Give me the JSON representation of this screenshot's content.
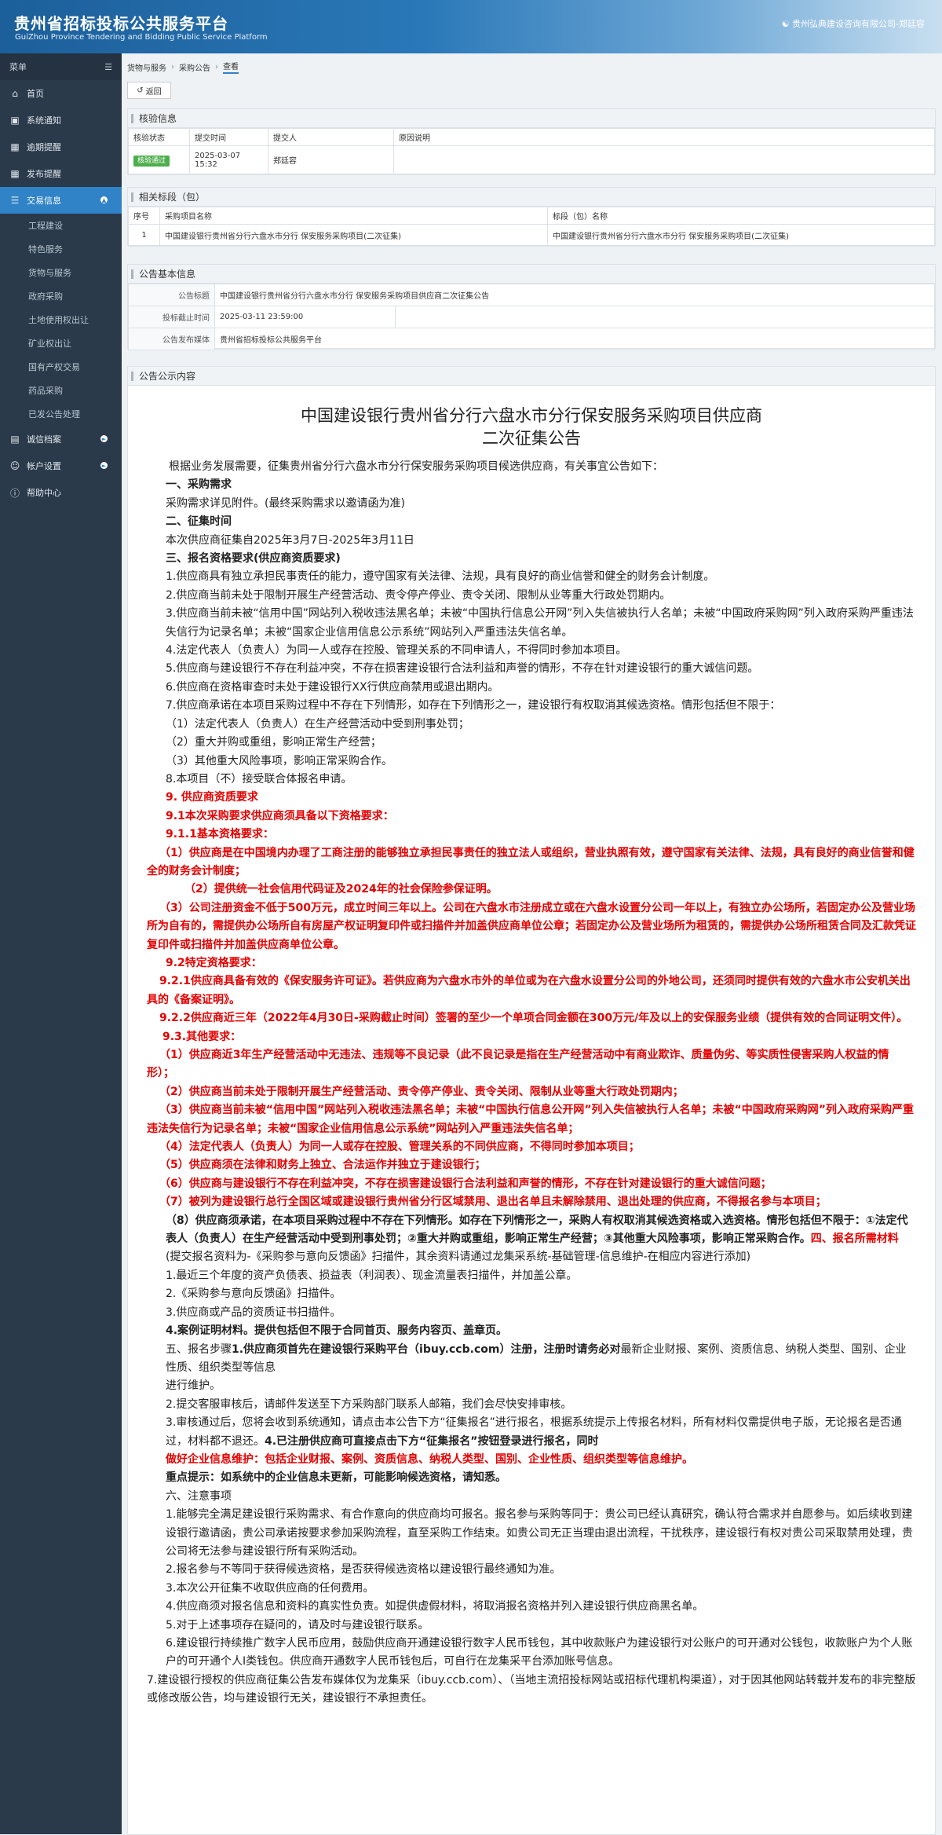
{
  "header": {
    "title": "贵州省招标投标公共服务平台",
    "subtitle": "GuiZhou Province Tendering and Bidding Public Service Platform",
    "user": "贵州弘典建设咨询有限公司-郑廷容"
  },
  "sidebar": {
    "menu_label": "菜单",
    "items": [
      {
        "label": "首页",
        "icon": "home-icon"
      },
      {
        "label": "系统通知",
        "icon": "monitor-icon"
      },
      {
        "label": "逾期提醒",
        "icon": "calendar-icon"
      },
      {
        "label": "发布提醒",
        "icon": "calendar-icon"
      },
      {
        "label": "交易信息",
        "icon": "list-icon"
      }
    ],
    "subitems": [
      "工程建设",
      "特色服务",
      "货物与服务",
      "政府采购",
      "土地使用权出让",
      "矿业权出让",
      "国有产权交易",
      "药品采购",
      "已发公告处理"
    ],
    "bottom": [
      {
        "label": "诚信档案"
      },
      {
        "label": "帐户设置"
      },
      {
        "label": "帮助中心"
      }
    ]
  },
  "breadcrumb": [
    "货物与服务",
    "采购公告",
    "查看"
  ],
  "back_label": "返回",
  "verify": {
    "title": "核验信息",
    "headers": [
      "核验状态",
      "提交时间",
      "提交人",
      "原因说明"
    ],
    "status": "核验通过",
    "time": "2025-03-07 15:32",
    "person": "郑廷容",
    "reason": ""
  },
  "sections": {
    "title": "相关标段（包）",
    "headers": [
      "序号",
      "采购项目名称",
      "标段（包）名称"
    ],
    "row": [
      "1",
      "中国建设银行贵州省分行六盘水市分行 保安服务采购项目(二次征集)",
      "中国建设银行贵州省分行六盘水市分行 保安服务采购项目(二次征集)"
    ]
  },
  "basic": {
    "title": "公告基本信息",
    "rows": [
      {
        "label": "公告标题",
        "value": "中国建设银行贵州省分行六盘水市分行 保安服务采购项目供应商二次征集公告"
      },
      {
        "label": "投标截止时间",
        "value": "2025-03-11 23:59:00"
      },
      {
        "label": "公告发布媒体",
        "value": "贵州省招标投标公共服务平台"
      }
    ]
  },
  "notice": {
    "panel_title": "公告公示内容",
    "title1": "中国建设银行贵州省分行六盘水市分行保安服务采购项目供应商",
    "title2": "二次征集公告",
    "p": [
      "根据业务发展需要，征集贵州省分行六盘水市分行保安服务采购项目候选供应商，有关事宜公告如下：",
      "一、采购需求",
      "采购需求详见附件。(最终采购需求以邀请函为准)",
      "二、征集时间",
      "本次供应商征集自2025年3月7日-2025年3月11日",
      "三、报名资格要求(供应商资质要求)",
      "1.供应商具有独立承担民事责任的能力，遵守国家有关法律、法规，具有良好的商业信誉和健全的财务会计制度。",
      "2.供应商当前未处于限制开展生产经营活动、责令停产停业、责令关闭、限制从业等重大行政处罚期内。",
      "3.供应商当前未被“信用中国”网站列入税收违法黑名单；未被“中国执行信息公开网”列入失信被执行人名单；未被“中国政府采购网”列入政府采购严重违法失信行为记录名单；未被“国家企业信用信息公示系统”网站列入严重违法失信名单。",
      "4.法定代表人（负责人）为同一人或存在控股、管理关系的不同申请人，不得同时参加本项目。",
      "5.供应商与建设银行不存在利益冲突，不存在损害建设银行合法利益和声誉的情形，不存在针对建设银行的重大诚信问题。",
      "6.供应商在资格审查时未处于建设银行XX行供应商禁用或退出期内。",
      "7.供应商承诺在本项目采购过程中不存在下列情形，如存在下列情形之一，建设银行有权取消其候选资格。情形包括但不限于：",
      "（1）法定代表人（负责人）在生产经营活动中受到刑事处罚；",
      "（2）重大并购或重组，影响正常生产经营；",
      "（3）其他重大风险事项，影响正常采购合作。",
      "8.本项目（不）接受联合体报名申请。",
      "9. 供应商资质要求",
      "9.1本次采购要求供应商须具备以下资格要求：",
      "9.1.1基本资格要求：",
      "（1）供应商是在中国境内办理了工商注册的能够独立承担民事责任的独立法人或组织，营业执照有效，遵守国家有关法律、法规，具有良好的商业信誉和健全的财务会计制度；",
      "（2）提供统一社会信用代码证及2024年的社会保险参保证明。",
      "（3）公司注册资金不低于500万元，成立时间三年以上。公司在六盘水市注册成立或在六盘水设置分公司一年以上，有独立办公场所，若固定办公及营业场所为自有的，需提供办公场所自有房屋产权证明复印件或扫描件并加盖供应商单位公章；若固定办公及营业场所为租赁的，需提供办公场所租赁合同及汇款凭证复印件或扫描件并加盖供应商单位公章。",
      "9.2特定资格要求：",
      "9.2.1供应商具备有效的《保安服务许可证》。若供应商为六盘水市外的单位或为在六盘水设置分公司的外地公司，还须同时提供有效的六盘水市公安机关出具的《备案证明》。",
      "9.2.2供应商近三年（2022年4月30日-采购截止时间）签署的至少一个单项合同金额在300万元/年及以上的安保服务业绩（提供有效的合同证明文件）。",
      "9.3.其他要求：",
      "（1）供应商近3年生产经营活动中无违法、违规等不良记录（此不良记录是指在生产经营活动中有商业欺诈、质量伪劣、等实质性侵害采购人权益的情形）；",
      "（2）供应商当前未处于限制开展生产经营活动、责令停产停业、责令关闭、限制从业等重大行政处罚期内；",
      "（3）供应商当前未被“信用中国”网站列入税收违法黑名单；未被“中国执行信息公开网”列入失信被执行人名单；未被“中国政府采购网”列入政府采购严重违法失信行为记录名单；未被“国家企业信用信息公示系统”网站列入严重违法失信名单；",
      "（4）法定代表人（负责人）为同一人或存在控股、管理关系的不同供应商，不得同时参加本项目；",
      "（5）供应商须在法律和财务上独立、合法运作并独立于建设银行；",
      "（6）供应商与建设银行不存在利益冲突，不存在损害建设银行合法利益和声誉的情形，不存在针对建设银行的重大诚信问题；",
      "（7）被列为建设银行总行全国区域或建设银行贵州省分行区域禁用、退出名单且未解除禁用、退出处理的供应商，不得报名参与本项目；",
      "（8）供应商须承诺，在本项目采购过程中不存在下列情形。如存在下列情形之一，采购人有权取消其候选资格或入选资格。情形包括但不限于：①法定代表人（负责人）在生产经营活动中受到刑事处罚；②重大并购或重组，影响正常生产经营；③其他重大风险事项，影响正常采购合作。",
      "四、报名所需材料",
      "(提交报名资料为-《采购参与意向反馈函》扫描件，其余资料请通过龙集采系统-基础管理-信息维护-在相应内容进行添加)",
      "1.最近三个年度的资产负债表、损益表（利润表）、现金流量表扫描件，并加盖公章。",
      "2.《采购参与意向反馈函》扫描件。",
      "3.供应商或产品的资质证书扫描件。",
      "4.案例证明材料。提供包括但不限于合同首页、服务内容页、盖章页。",
      "五、报名步骤",
      "1.供应商须首先在建设银行采购平台（ibuy.ccb.com）注册，注册时请务必对",
      "最新企业财报、案例、资质信息、纳税人类型、国别、企业性质、组织类型等信息",
      "进行维护。",
      "2.提交客服审核后，请邮件发送至下方采购部门联系人邮箱，我们会尽快安排审核。",
      "3.审核通过后，您将会收到系统通知，请点击本公告下方“征集报名”进行报名，根据系统提示上传报名材料，所有材料仅需提供电子版，无论报名是否通过，材料都不退还。",
      "4.已注册供应商可直接点击下方“征集报名”按钮登录进行报名，同时",
      "做好企业信息维护：包括企业财报、案例、资质信息、纳税人类型、国别、企业性质、组织类型等信息维护。",
      "重点提示：如系统中的企业信息未更新，可能影响候选资格，请知悉。",
      "六、注意事项",
      "1.能够完全满足建设银行采购需求、有合作意向的供应商均可报名。报名参与采购等同于：贵公司已经认真研究，确认符合需求并自愿参与。如后续收到建设银行邀请函，贵公司承诺按要求参加采购流程，直至采购工作结束。如贵公司无正当理由退出流程，干扰秩序，建设银行有权对贵公司采取禁用处理，贵公司将无法参与建设银行所有采购活动。",
      "2.报名参与不等同于获得候选资格，是否获得候选资格以建设银行最终通知为准。",
      "3.本次公开征集不收取供应商的任何费用。",
      "4.供应商须对报名信息和资料的真实性负责。如提供虚假材料，将取消报名资格并列入建设银行供应商黑名单。",
      "5.对于上述事项存在疑问的，请及时与建设银行联系。",
      "6.建设银行持续推广数字人民币应用，鼓励供应商开通建设银行数字人民币钱包，其中收款账户为建设银行对公账户的可开通对公钱包，收款账户为个人账户的可开通个人I类钱包。供应商开通数字人民币钱包后，可自行在龙集采平台添加账号信息。",
      "7.建设银行授权的供应商征集公告发布媒体仅为龙集采（ibuy.ccb.com）、（当地主流招投标网站或招标代理机构渠道），对于因其他网站转载并发布的非完整版或修改版公告，均与建设银行无关，建设银行不承担责任。"
    ]
  }
}
